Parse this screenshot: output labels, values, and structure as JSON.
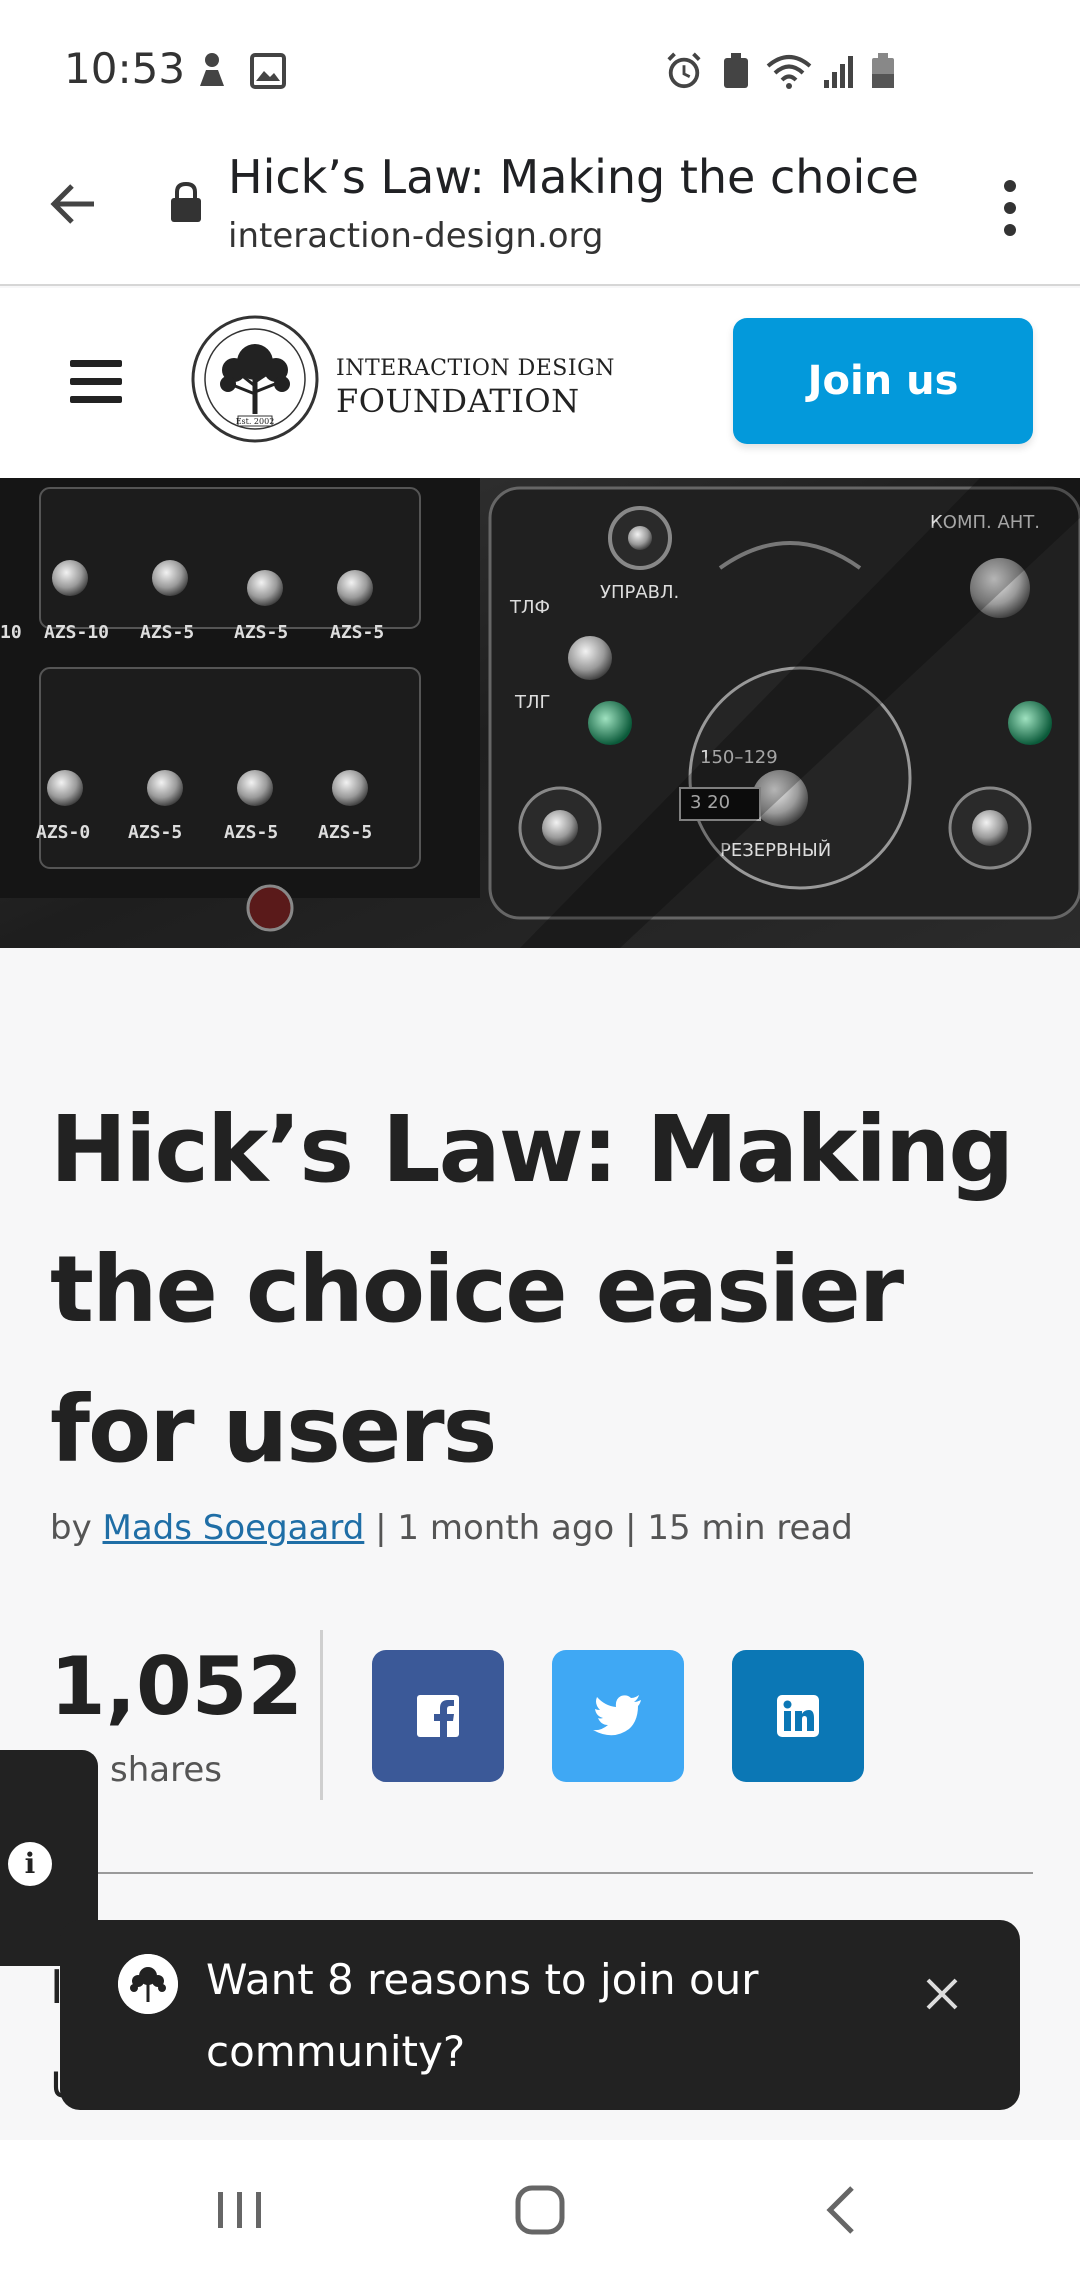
{
  "status_bar": {
    "time": "10:53"
  },
  "browser": {
    "page_title": "Hick’s Law: Making the choice …",
    "domain": "interaction-design.org"
  },
  "header": {
    "logo_line1": "INTERACTION DESIGN",
    "logo_line2": "FOUNDATION",
    "logo_seal_text": "INTERACTION DESIGN FOUNDATION · Est. 2002",
    "join_label": "Join us"
  },
  "colors": {
    "accent": "#0399db",
    "facebook": "#3b5998",
    "twitter": "#3fa8f4",
    "linkedin": "#0b77b5",
    "link": "#1f6ea6",
    "toast_bg": "#222222"
  },
  "article": {
    "title": "Hick’s Law: Making the choice easier for users",
    "byline_prefix": "by",
    "author": "Mads Soegaard",
    "byline_sep1": "|",
    "time_ago": "1 month ago",
    "byline_sep2": "|",
    "read_time": "15 min read",
    "share_count": "1,052",
    "share_label": "shares",
    "social_icons": [
      "facebook-icon",
      "twitter-icon",
      "linkedin-icon"
    ],
    "partial_line1": "I",
    "partial_line2": "u"
  },
  "toast": {
    "message": "Want 8 reasons to join our community?"
  },
  "floating_tab": {
    "icon": "info-icon"
  }
}
